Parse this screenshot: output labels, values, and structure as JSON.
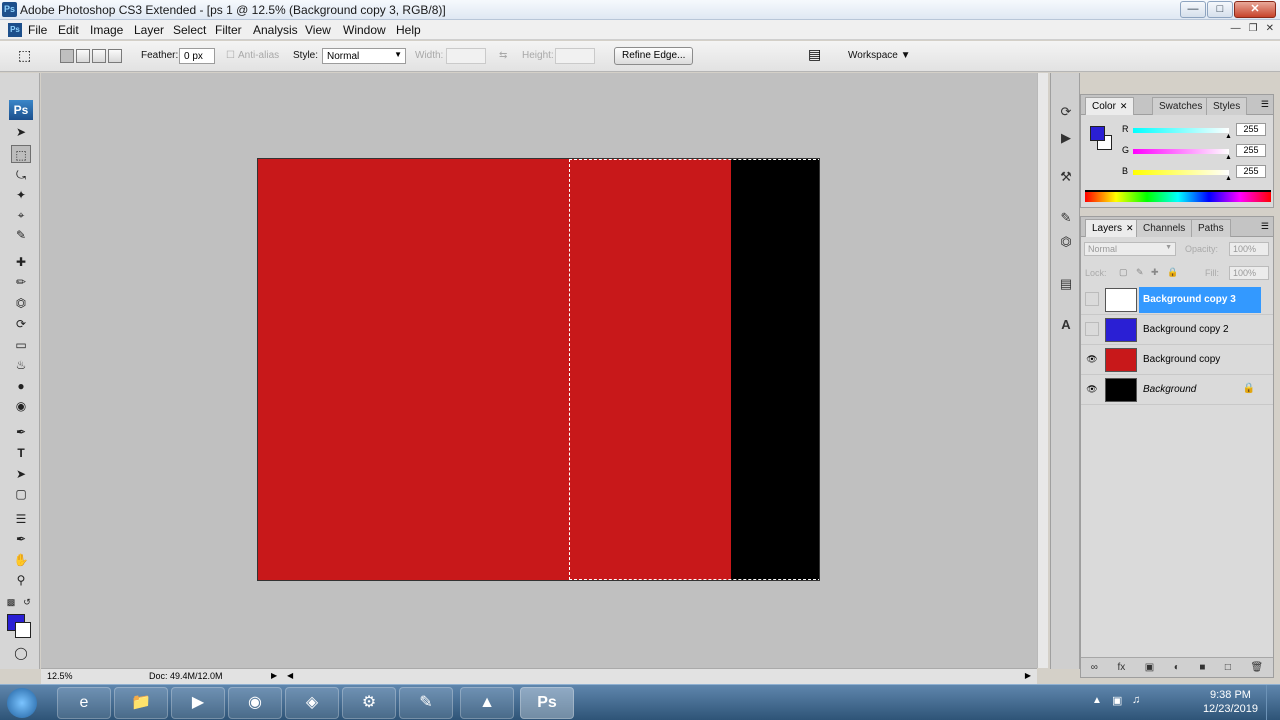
{
  "titlebar": {
    "app_icon": "Ps",
    "title": "Adobe Photoshop CS3 Extended - [ps 1 @ 12.5% (Background copy 3, RGB/8)]"
  },
  "menubar": {
    "items": [
      "File",
      "Edit",
      "Image",
      "Layer",
      "Select",
      "Filter",
      "Analysis",
      "View",
      "Window",
      "Help"
    ]
  },
  "options": {
    "feather_label": "Feather:",
    "feather_value": "0 px",
    "antialias_label": "Anti-alias",
    "style_label": "Style:",
    "style_value": "Normal",
    "width_label": "Width:",
    "height_label": "Height:",
    "refine_edge": "Refine Edge...",
    "workspace": "Workspace"
  },
  "toolbar": {
    "logo": "Ps",
    "foreground_color": "#2a1fd4",
    "background_color": "#ffffff"
  },
  "document": {
    "fill_color": "#c8181a",
    "band_color": "#000000"
  },
  "status": {
    "zoom": "12.5%",
    "doc_size": "Doc: 49.4M/12.0M"
  },
  "color_panel": {
    "tabs": [
      "Color",
      "Swatches",
      "Styles"
    ],
    "active_tab": "Color",
    "channels": [
      {
        "label": "R",
        "value": "255"
      },
      {
        "label": "G",
        "value": "255"
      },
      {
        "label": "B",
        "value": "255"
      }
    ]
  },
  "layers_panel": {
    "tabs": [
      "Layers",
      "Channels",
      "Paths"
    ],
    "active_tab": "Layers",
    "blend_mode": "Normal",
    "opacity_label": "Opacity:",
    "opacity_value": "100%",
    "lock_label": "Lock:",
    "fill_label": "Fill:",
    "fill_value": "100%",
    "layers": [
      {
        "name": "Background copy 3",
        "visible": false,
        "selected": true,
        "thumb_color": "#ffffff"
      },
      {
        "name": "Background copy 2",
        "visible": false,
        "selected": false,
        "thumb_color": "#2a1fd4"
      },
      {
        "name": "Background copy",
        "visible": true,
        "selected": false,
        "thumb_color": "#c8181a"
      },
      {
        "name": "Background",
        "visible": true,
        "selected": false,
        "thumb_color": "#000000",
        "locked": true
      }
    ]
  },
  "taskbar": {
    "apps": [
      "windows-explorer",
      "internet-explorer",
      "file-manager",
      "media-player",
      "chrome",
      "firefox",
      "app",
      "tool",
      "vlc",
      "photoshop"
    ],
    "active_app": "photoshop",
    "time": "9:38 PM",
    "date": "12/23/2019"
  }
}
